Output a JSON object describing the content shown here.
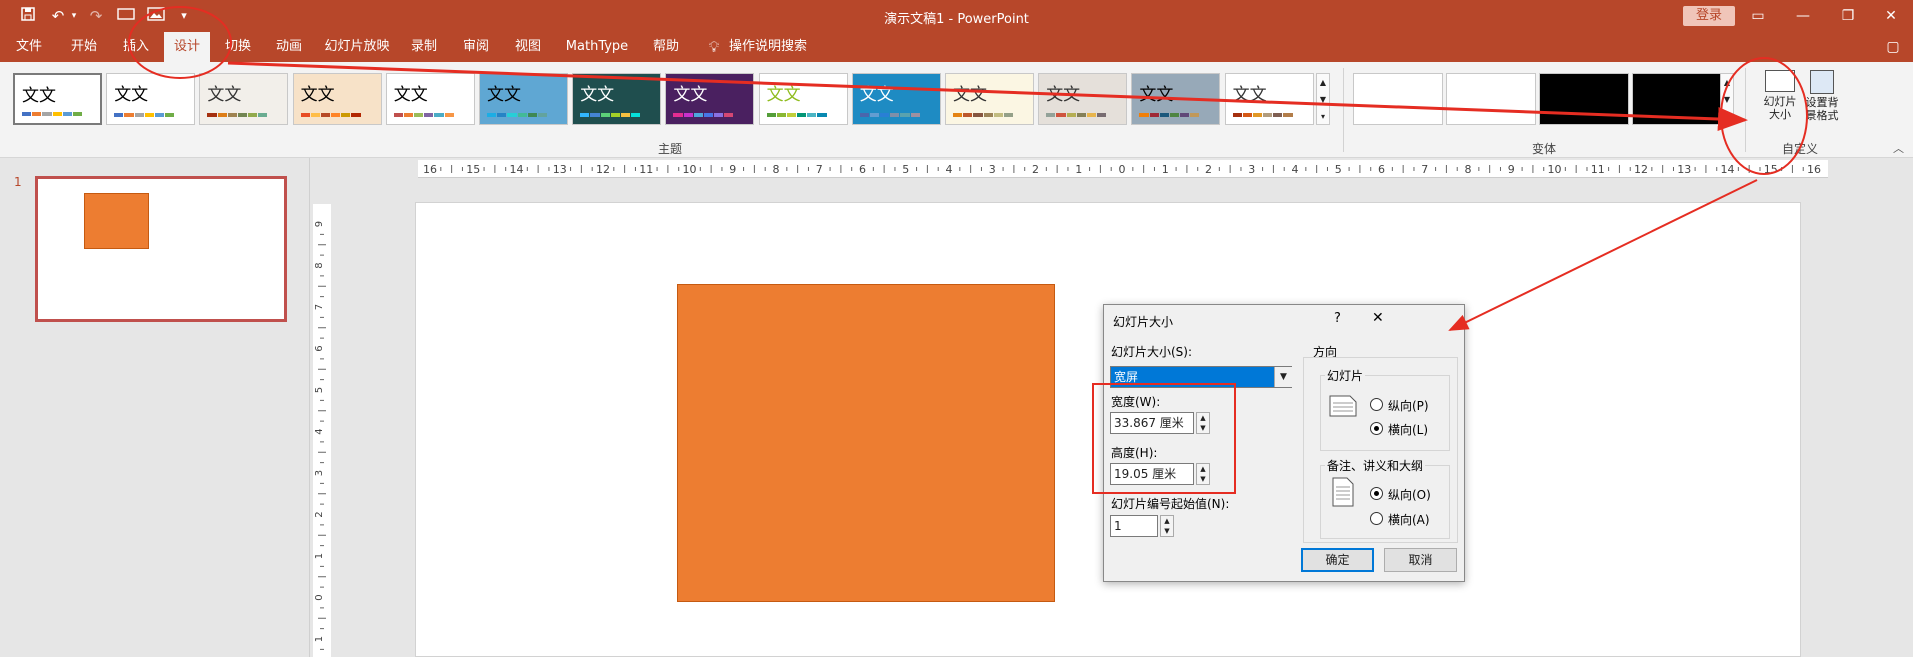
{
  "window": {
    "title": "演示文稿1 - PowerPoint",
    "login": "登录"
  },
  "qat": {
    "save_icon": "save-icon",
    "undo_icon": "undo-icon",
    "redo_icon": "redo-icon",
    "customize": "▾"
  },
  "tabs": [
    "文件",
    "开始",
    "插入",
    "设计",
    "切换",
    "动画",
    "幻灯片放映",
    "录制",
    "审阅",
    "视图",
    "MathType",
    "帮助",
    "操作说明搜索"
  ],
  "ribbon": {
    "themes_label": "主题",
    "variants_label": "变体",
    "customize_label": "自定义",
    "theme_sample_text": "文文",
    "slide_size_label": "幻灯片大小",
    "bg_format_label": "设置背景格式"
  },
  "themes": [
    {
      "bg": "#ffffff",
      "fg": "#000000",
      "bars": [
        "#4472c4",
        "#ed7d31",
        "#a5a5a5",
        "#ffc000",
        "#5b9bd5",
        "#70ad47"
      ]
    },
    {
      "bg": "#ffffff",
      "fg": "#000000",
      "bars": [
        "#4472c4",
        "#ed7d31",
        "#a5a5a5",
        "#ffc000",
        "#5b9bd5",
        "#70ad47"
      ]
    },
    {
      "bg": "#f2efea",
      "fg": "#333333",
      "bars": [
        "#a53010",
        "#de7e18",
        "#9f8351",
        "#728653",
        "#92aa4c",
        "#6aac91"
      ]
    },
    {
      "bg": "#f7e2c8",
      "fg": "#000000",
      "bars": [
        "#e84c22",
        "#ffbd47",
        "#b64926",
        "#ff8427",
        "#cc9900",
        "#b22600"
      ]
    },
    {
      "bg": "#ffffff",
      "fg": "#000000",
      "bars": [
        "#c0504d",
        "#ed7d31",
        "#9bbb59",
        "#8064a2",
        "#4bacc6",
        "#f79646"
      ]
    },
    {
      "bg": "#5fa7d3",
      "fg": "#000000",
      "bars": [
        "#1cade4",
        "#2683c6",
        "#27ced7",
        "#42ba97",
        "#3e8853",
        "#62a39f"
      ]
    },
    {
      "bg": "#1f4e4e",
      "fg": "#ffffff",
      "bars": [
        "#31b6fd",
        "#4584d3",
        "#5bd078",
        "#a5d028",
        "#f5c040",
        "#05e0db"
      ]
    },
    {
      "bg": "#4a2060",
      "fg": "#ffffff",
      "bars": [
        "#e32d91",
        "#c830cc",
        "#4ea6dc",
        "#4775e7",
        "#8971e1",
        "#d54773"
      ]
    },
    {
      "bg": "#ffffff",
      "fg": "#8fbc1d",
      "bars": [
        "#549e39",
        "#8ab833",
        "#c0cf3a",
        "#029676",
        "#4ab5c4",
        "#0989b1"
      ]
    },
    {
      "bg": "#1e8bc3",
      "fg": "#ffffff",
      "bars": [
        "#4a66ac",
        "#629dd1",
        "#297fd5",
        "#7f8fa9",
        "#5aa2ae",
        "#9d90a0"
      ]
    },
    {
      "bg": "#fbf6e3",
      "fg": "#333333",
      "bars": [
        "#e48312",
        "#bd582c",
        "#865640",
        "#9b8357",
        "#c2bc80",
        "#94a088"
      ]
    },
    {
      "bg": "#e5e0da",
      "fg": "#333333",
      "bars": [
        "#93a299",
        "#cf543f",
        "#b5ae53",
        "#848058",
        "#e8b54d",
        "#786c71"
      ]
    },
    {
      "bg": "#97a9b8",
      "fg": "#000000",
      "bars": [
        "#f07f09",
        "#9f2936",
        "#1b587c",
        "#4e8542",
        "#604878",
        "#c19859"
      ]
    },
    {
      "bg": "#ffffff",
      "fg": "#333333",
      "bars": [
        "#a5300f",
        "#d55816",
        "#e19825",
        "#b19c7d",
        "#7f5f52",
        "#b27d49"
      ]
    }
  ],
  "variants": [
    {
      "bg": "#ffffff"
    },
    {
      "bg": "#ffffff"
    },
    {
      "bg": "#000000"
    },
    {
      "bg": "#000000"
    }
  ],
  "ruler": {
    "h_labels": [
      "16",
      "15",
      "14",
      "13",
      "12",
      "11",
      "10",
      "9",
      "8",
      "7",
      "6",
      "5",
      "4",
      "3",
      "2",
      "1",
      "0",
      "1",
      "2",
      "3",
      "4",
      "5",
      "6",
      "7",
      "8",
      "9",
      "10",
      "11",
      "12",
      "13",
      "14",
      "15",
      "16"
    ],
    "v_labels": [
      "9",
      "8",
      "7",
      "6",
      "5",
      "4",
      "3",
      "2",
      "1",
      "0",
      "1"
    ]
  },
  "slides_pane": {
    "slide_number": "1"
  },
  "dialog": {
    "title": "幻灯片大小",
    "help": "?",
    "close": "✕",
    "size_label": "幻灯片大小(S):",
    "size_value": "宽屏",
    "width_label": "宽度(W):",
    "width_value": "33.867 厘米",
    "height_label": "高度(H):",
    "height_value": "19.05 厘米",
    "number_from_label": "幻灯片编号起始值(N):",
    "number_from_value": "1",
    "orientation_label": "方向",
    "slides_group": "幻灯片",
    "portrait_p": "纵向(P)",
    "landscape_l": "横向(L)",
    "notes_group": "备注、讲义和大纲",
    "portrait_o": "纵向(O)",
    "landscape_a": "横向(A)",
    "ok": "确定",
    "cancel": "取消"
  }
}
